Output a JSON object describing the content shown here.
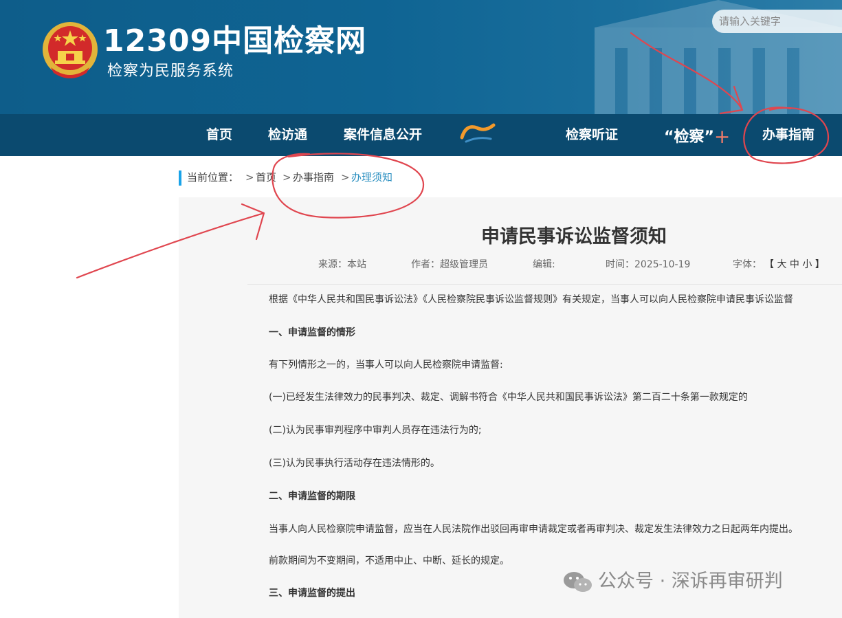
{
  "header": {
    "logo_main": "12309中国检察网",
    "logo_sub": "检察为民服务系统",
    "search_placeholder": "请输入关键字"
  },
  "nav": {
    "items": [
      "首页",
      "检访通",
      "案件信息公开",
      "检察听证",
      "“检察”",
      "办事指南"
    ]
  },
  "breadcrumb": {
    "label": "当前位置：",
    "sep": ">",
    "items": [
      "首页",
      "办事指南",
      "办理须知"
    ]
  },
  "article": {
    "title": "申请民事诉讼监督须知",
    "meta": {
      "source": "来源：本站",
      "author": "作者：超级管理员",
      "editor": "编辑:",
      "time": "时间：2025-10-19",
      "font_label": "字体：",
      "font_sizes": "【 大 中 小 】"
    },
    "paragraphs": [
      "根据《中华人民共和国民事诉讼法》《人民检察院民事诉讼监督规则》有关规定，当事人可以向人民检察院申请民事诉讼监督",
      "一、申请监督的情形",
      "有下列情形之一的，当事人可以向人民检察院申请监督:",
      "(一)已经发生法律效力的民事判决、裁定、调解书符合《中华人民共和国民事诉讼法》第二百二十条第一款规定的",
      "(二)认为民事审判程序中审判人员存在违法行为的;",
      "(三)认为民事执行活动存在违法情形的。",
      "二、申请监督的期限",
      "当事人向人民检察院申请监督，应当在人民法院作出驳回再审申请裁定或者再审判决、裁定发生法律效力之日起两年内提出。",
      "前款期间为不变期间，不适用中止、中断、延长的规定。",
      "三、申请监督的提出"
    ]
  },
  "watermark": "公众号 · 深诉再审研判",
  "colors": {
    "header_bg": "#0f6493",
    "nav_bg": "#0b4a6f",
    "crumb_accent": "#1aa3e8",
    "crumb_active": "#2a8fc0",
    "annotation": "#e0464f"
  }
}
